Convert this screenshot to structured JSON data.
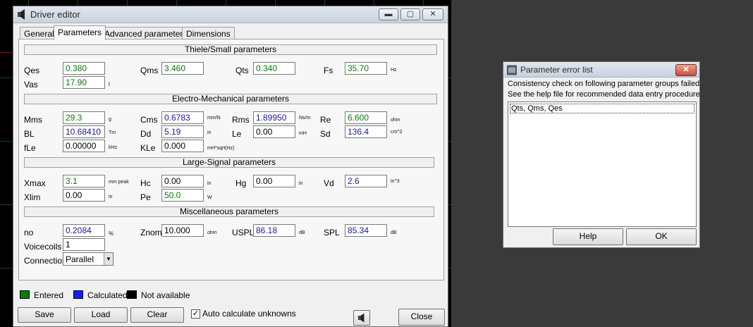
{
  "driver_editor": {
    "title": "Driver editor",
    "tabs": [
      {
        "label": "General"
      },
      {
        "label": "Parameters"
      },
      {
        "label": "Advanced parameters"
      },
      {
        "label": "Dimensions"
      }
    ],
    "groups": {
      "thiele_small": "Thiele/Small parameters",
      "electro_mechanical": "Electro-Mechanical parameters",
      "large_signal": "Large-Signal parameters",
      "misc": "Miscellaneous parameters"
    },
    "params": {
      "qes": {
        "label": "Qes",
        "value": "0.380",
        "unit": ""
      },
      "qms": {
        "label": "Qms",
        "value": "3.460",
        "unit": ""
      },
      "qts": {
        "label": "Qts",
        "value": "0.340",
        "unit": ""
      },
      "fs": {
        "label": "Fs",
        "value": "35.70",
        "unit": "Hz"
      },
      "vas": {
        "label": "Vas",
        "value": "17.90",
        "unit": "l"
      },
      "mms": {
        "label": "Mms",
        "value": "29.3",
        "unit": "g"
      },
      "cms": {
        "label": "Cms",
        "value": "0.6783",
        "unit": "mm/N"
      },
      "rms": {
        "label": "Rms",
        "value": "1.89950",
        "unit": "Ns/m"
      },
      "re": {
        "label": "Re",
        "value": "6.600",
        "unit": "ohm"
      },
      "bl": {
        "label": "BL",
        "value": "10.68410",
        "unit": "Tm"
      },
      "dd": {
        "label": "Dd",
        "value": "5.19",
        "unit": "in"
      },
      "le": {
        "label": "Le",
        "value": "0.00",
        "unit": "mH"
      },
      "sd": {
        "label": "Sd",
        "value": "136.4",
        "unit": "cm^2"
      },
      "fle": {
        "label": "fLe",
        "value": "0.00000",
        "unit": "kHz"
      },
      "kle": {
        "label": "KLe",
        "value": "0.000",
        "unit": "mH*sqrt(Hz)"
      },
      "xmax": {
        "label": "Xmax",
        "value": "3.1",
        "unit": "mm  peak"
      },
      "hc": {
        "label": "Hc",
        "value": "0.00",
        "unit": "in"
      },
      "hg": {
        "label": "Hg",
        "value": "0.00",
        "unit": "in"
      },
      "vd": {
        "label": "Vd",
        "value": "2.6",
        "unit": "in^3"
      },
      "xlim": {
        "label": "Xlim",
        "value": "0.00",
        "unit": "in"
      },
      "pe": {
        "label": "Pe",
        "value": "50.0",
        "unit": "W"
      },
      "no": {
        "label": "no",
        "value": "0.2084",
        "unit": "%"
      },
      "znom": {
        "label": "Znom",
        "value": "10.000",
        "unit": "ohm"
      },
      "uspl": {
        "label": "USPL",
        "value": "86.18",
        "unit": "dB"
      },
      "spl": {
        "label": "SPL",
        "value": "85.34",
        "unit": "dB"
      },
      "voicecoils": {
        "label": "Voicecoils",
        "value": "1"
      },
      "connection": {
        "label": "Connection",
        "value": "Parallel"
      }
    },
    "legend": {
      "entered": "Entered",
      "calculated": "Calculated",
      "not_available": "Not available",
      "colors": {
        "entered": "#0a7a0a",
        "calculated": "#1a1a9a",
        "not_available": "#000000"
      }
    },
    "buttons": {
      "save": "Save",
      "load": "Load",
      "clear": "Clear",
      "close": "Close"
    },
    "auto_calc": {
      "label": "Auto calculate unknowns",
      "checked": true
    }
  },
  "error_dialog": {
    "title": "Parameter error list",
    "line1": "Consistency check on following parameter groups failed.",
    "line2": "See the help file for recommended data entry procedure.",
    "items": [
      "Qts, Qms, Qes"
    ],
    "help_button": "Help",
    "ok_button": "OK"
  }
}
